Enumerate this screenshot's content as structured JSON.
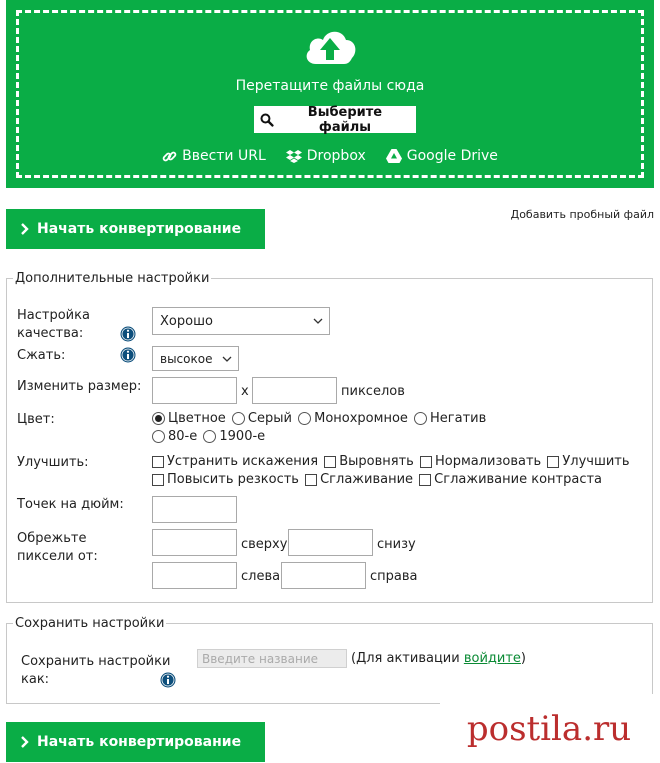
{
  "dropzone": {
    "drop_text": "Перетащите файлы сюда",
    "choose_label": "Выберите файлы",
    "links": [
      {
        "icon": "link-icon",
        "label": "Ввести URL"
      },
      {
        "icon": "dropbox-icon",
        "label": "Dropbox"
      },
      {
        "icon": "google-drive-icon",
        "label": "Google Drive"
      }
    ],
    "color": "#0aad46"
  },
  "convert_label": "Начать конвертирование",
  "sample_label": "Добавить пробный файл",
  "settings": {
    "legend": "Дополнительные настройки",
    "quality": {
      "label": "Настройка качества:",
      "value": "Хорошо"
    },
    "compress": {
      "label": "Сжать:",
      "value": "высокое"
    },
    "resize": {
      "label": "Изменить размер:",
      "x": "x",
      "unit": "пикселов"
    },
    "color": {
      "label": "Цвет:",
      "options": [
        "Цветное",
        "Серый",
        "Монохромное",
        "Негатив",
        "80-е",
        "1900-е"
      ],
      "selected": "Цветное"
    },
    "enhance": {
      "label": "Улучшить:",
      "options": [
        "Устранить искажения",
        "Выровнять",
        "Нормализовать",
        "Улучшить",
        "Повысить резкость",
        "Сглаживание",
        "Сглаживание контраста"
      ]
    },
    "dpi": {
      "label": "Точек на дюйм:"
    },
    "crop": {
      "label": "Обрежьте пиксели от:",
      "top": "сверху",
      "bottom": "снизу",
      "left": "слева",
      "right": "справа"
    }
  },
  "save": {
    "legend": "Сохранить настройки",
    "label": "Сохранить настройки как:",
    "placeholder": "Введите название",
    "note_prefix": "(Для активации ",
    "login": "войдите",
    "note_suffix": ")"
  },
  "watermark": "postila.ru"
}
